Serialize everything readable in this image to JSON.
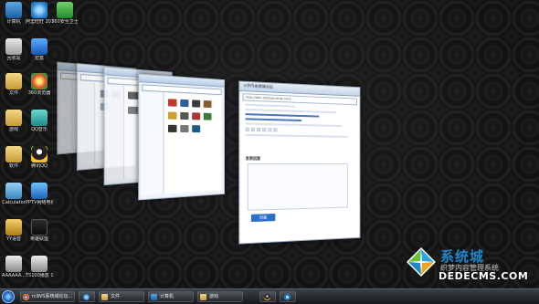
{
  "desktop_icons": [
    {
      "name": "computer",
      "label": "计算机"
    },
    {
      "name": "ie",
      "label": "阿里旺旺 2012"
    },
    {
      "name": "360-safe",
      "label": "360安全卫士"
    },
    {
      "name": "recycle-bin",
      "label": "回收站"
    },
    {
      "name": "shortcut",
      "label": "宏基"
    },
    {
      "name": "folder-file",
      "label": "文件"
    },
    {
      "name": "360-browser",
      "label": "360浏览器"
    },
    {
      "name": "folder-game",
      "label": "游戏"
    },
    {
      "name": "qq-music",
      "label": "QQ音乐"
    },
    {
      "name": "folder-software",
      "label": "软件"
    },
    {
      "name": "tencent-qq",
      "label": "腾讯QQ"
    },
    {
      "name": "calculator",
      "label": "Calculator"
    },
    {
      "name": "pptv",
      "label": "PPTV网络电视"
    },
    {
      "name": "yy-voice",
      "label": "YY语音"
    },
    {
      "name": "game-app",
      "label": "英雄联盟"
    },
    {
      "name": "aaaa",
      "label": "AAAAAA..."
    },
    {
      "name": "ts100",
      "label": "TS100播放 1.5.5(..."
    }
  ],
  "browser_window": {
    "tab_title": "rc9VS系统城论坛",
    "url": "http://bbs.xitongcheng.com/",
    "section_title": "发表回复",
    "reply_label": "回复"
  },
  "taskbar": {
    "items": [
      {
        "name": "chrome",
        "label": "rc9VS系统城论坛..."
      },
      {
        "name": "ie",
        "label": ""
      },
      {
        "name": "explorer-file",
        "label": "文件"
      },
      {
        "name": "explorer-computer",
        "label": "计算机"
      },
      {
        "name": "explorer-game",
        "label": "游戏"
      },
      {
        "name": "qq",
        "label": ""
      },
      {
        "name": "kugou",
        "label": ""
      }
    ]
  },
  "watermark": {
    "brand": "系统城",
    "brand_overlay": "织梦内容管理系统",
    "domain": "DEDECMS.COM",
    "colors": {
      "blue": "#1f86c8",
      "green": "#6cbf3a",
      "cyan": "#2aa6e0"
    }
  }
}
